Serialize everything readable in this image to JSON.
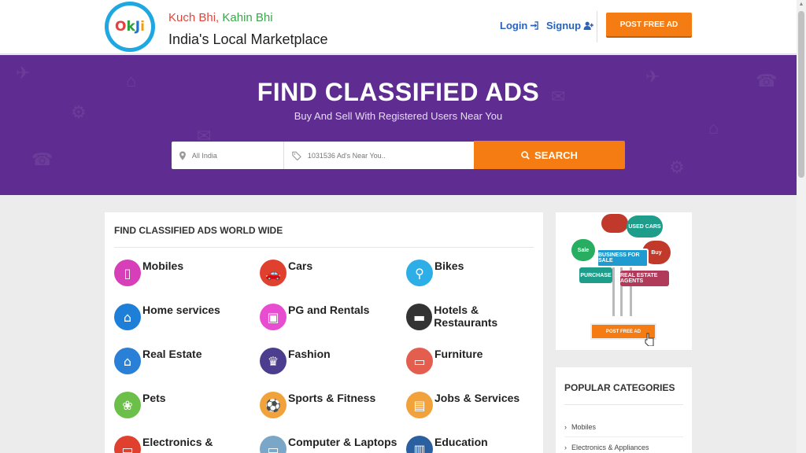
{
  "header": {
    "logo_text": "OkJi",
    "tagline_a": "Kuch Bhi,",
    "tagline_b": "Kahin Bhi",
    "subtitle": "India's Local Marketplace",
    "login_label": "Login",
    "signup_label": "Signup",
    "post_ad_label": "POST FREE AD"
  },
  "hero": {
    "title": "FIND CLASSIFIED ADS",
    "subtitle": "Buy And Sell With Registered Users Near You",
    "location_placeholder": "All India",
    "query_placeholder": "1031536 Ad's Near You..",
    "search_label": "SEARCH"
  },
  "categories": {
    "title": "FIND CLASSIFIED ADS WORLD WIDE",
    "items": [
      {
        "label": "Mobiles",
        "icon": "mobile-icon",
        "color": "#d63fb8"
      },
      {
        "label": "Cars",
        "icon": "car-icon",
        "color": "#e0412f"
      },
      {
        "label": "Bikes",
        "icon": "bike-icon",
        "color": "#2eaee6"
      },
      {
        "label": "Home services",
        "icon": "home-services-icon",
        "color": "#1e7fd8"
      },
      {
        "label": "PG and Rentals",
        "icon": "rentals-icon",
        "color": "#e84cd0"
      },
      {
        "label": "Hotels & Restaurants",
        "icon": "hotel-icon",
        "color": "#333333"
      },
      {
        "label": "Real Estate",
        "icon": "house-icon",
        "color": "#2a7fd6"
      },
      {
        "label": "Fashion",
        "icon": "fashion-icon",
        "color": "#4c3d8f"
      },
      {
        "label": "Furniture",
        "icon": "sofa-icon",
        "color": "#e35e4e"
      },
      {
        "label": "Pets",
        "icon": "paw-icon",
        "color": "#6cc04a"
      },
      {
        "label": "Sports & Fitness",
        "icon": "sports-icon",
        "color": "#f2a23b"
      },
      {
        "label": "Jobs & Services",
        "icon": "briefcase-icon",
        "color": "#f2a23b"
      },
      {
        "label": "Electronics &",
        "icon": "electronics-icon",
        "color": "#e0412f"
      },
      {
        "label": "Computer & Laptops",
        "icon": "computer-icon",
        "color": "#7aa6c8"
      },
      {
        "label": "Education",
        "icon": "book-icon",
        "color": "#2a5fa0"
      }
    ]
  },
  "ad_banner": {
    "signs": [
      "USED CARS",
      "BUSINESS FOR SALE",
      "PURCHASE",
      "REAL ESTATE AGENTS",
      "Sale",
      "Buy"
    ],
    "post_label": "POST FREE AD"
  },
  "popular": {
    "title": "POPULAR CATEGORIES",
    "items": [
      "Mobiles",
      "Electronics & Appliances"
    ]
  },
  "colors": {
    "brand_purple": "#5f2d91",
    "accent_orange": "#f57c12",
    "link_blue": "#2a63b8"
  }
}
